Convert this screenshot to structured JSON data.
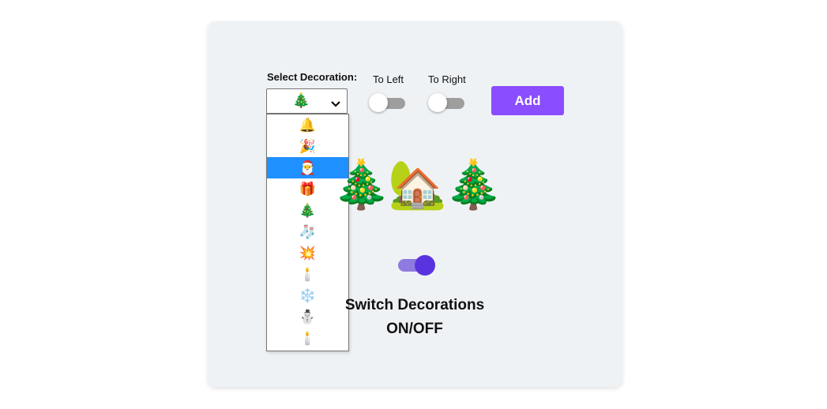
{
  "controls": {
    "select_label": "Select Decoration:",
    "left_label": "To Left",
    "right_label": "To Right",
    "add_label": "Add",
    "selected_value": "🎄",
    "left_toggle_on": false,
    "right_toggle_on": false
  },
  "dropdown": {
    "options": [
      "🔔",
      "🎉",
      "🎅",
      "🎁",
      "🎄",
      "🧦",
      "💥",
      "🕯️",
      "❄️",
      "⛄",
      "🕯️"
    ],
    "highlighted_index": 2,
    "highlight_color": "#1e90ff"
  },
  "decorations": [
    "🎄",
    "🏡",
    "🎄"
  ],
  "main_switch": {
    "label_line1": "Switch Decorations",
    "label_line2": "ON/OFF",
    "on": true,
    "track_color": "#8f7ae0",
    "knob_color": "#5a33e0"
  },
  "colors": {
    "card_bg": "#eff2f5",
    "add_button_bg": "#8a4dff"
  }
}
